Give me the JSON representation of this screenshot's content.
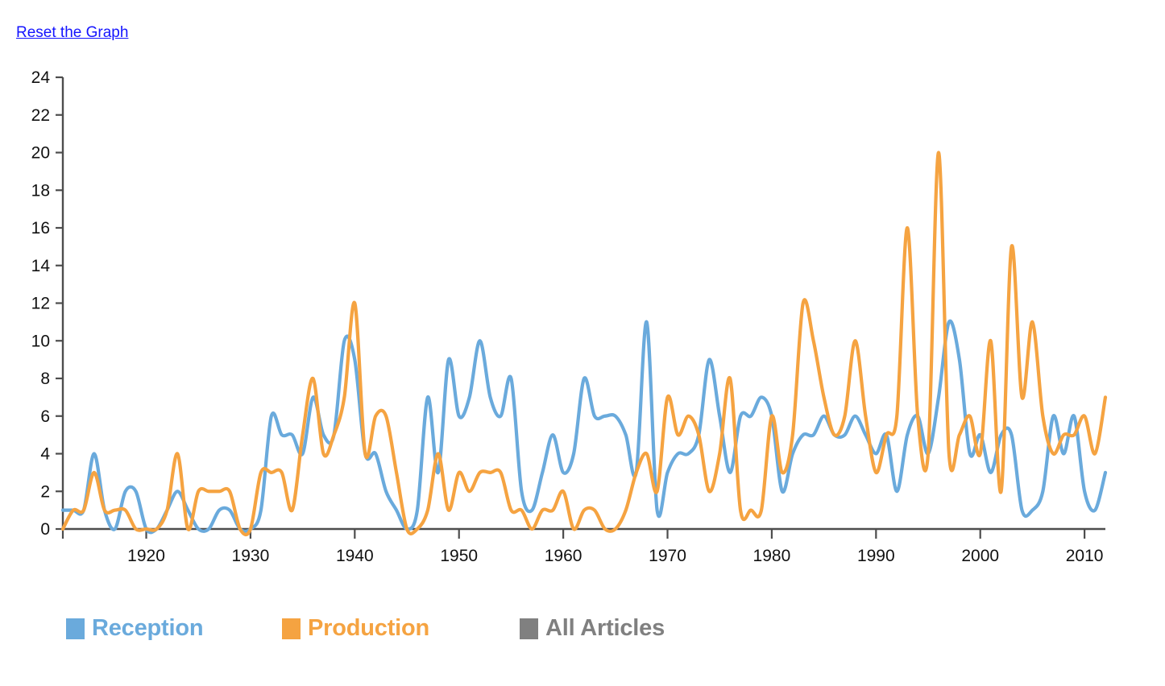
{
  "page": {
    "reset_link_label": "Reset the Graph",
    "link_color": "#1414ff"
  },
  "legend": {
    "entries": [
      {
        "label": "Reception",
        "color": "#6aaadc",
        "icon": "square-swatch-icon"
      },
      {
        "label": "Production",
        "color": "#f5a341",
        "icon": "square-swatch-icon"
      },
      {
        "label": "All Articles",
        "color": "#808080",
        "icon": "square-swatch-icon"
      }
    ]
  },
  "chart_data": {
    "type": "line",
    "title": "",
    "xlabel": "",
    "ylabel": "",
    "xlim": [
      1912,
      2012
    ],
    "ylim": [
      0,
      24
    ],
    "y_ticks": [
      0,
      2,
      4,
      6,
      8,
      10,
      12,
      14,
      16,
      18,
      20,
      22,
      24
    ],
    "x_ticks": [
      1920,
      1930,
      1940,
      1950,
      1960,
      1970,
      1980,
      1990,
      2000,
      2010
    ],
    "grid": false,
    "legend_position": "bottom",
    "smoothing": "monotone-spline",
    "x": [
      1912,
      1913,
      1914,
      1915,
      1916,
      1917,
      1918,
      1919,
      1920,
      1921,
      1922,
      1923,
      1924,
      1925,
      1926,
      1927,
      1928,
      1929,
      1930,
      1931,
      1932,
      1933,
      1934,
      1935,
      1936,
      1937,
      1938,
      1939,
      1940,
      1941,
      1942,
      1943,
      1944,
      1945,
      1946,
      1947,
      1948,
      1949,
      1950,
      1951,
      1952,
      1953,
      1954,
      1955,
      1956,
      1957,
      1958,
      1959,
      1960,
      1961,
      1962,
      1963,
      1964,
      1965,
      1966,
      1967,
      1968,
      1969,
      1970,
      1971,
      1972,
      1973,
      1974,
      1975,
      1976,
      1977,
      1978,
      1979,
      1980,
      1981,
      1982,
      1983,
      1984,
      1985,
      1986,
      1987,
      1988,
      1989,
      1990,
      1991,
      1992,
      1993,
      1994,
      1995,
      1996,
      1997,
      1998,
      1999,
      2000,
      2001,
      2002,
      2003,
      2004,
      2005,
      2006,
      2007,
      2008,
      2009,
      2010,
      2011,
      2012
    ],
    "series": [
      {
        "name": "Reception",
        "color": "#6aaadc",
        "values": [
          1,
          1,
          1,
          4,
          1,
          0,
          2,
          2,
          0,
          0,
          1,
          2,
          1,
          0,
          0,
          1,
          1,
          0,
          0,
          1,
          6,
          5,
          5,
          4,
          7,
          5,
          5,
          10,
          9,
          4,
          4,
          2,
          1,
          0,
          1,
          7,
          3,
          9,
          6,
          7,
          10,
          7,
          6,
          8,
          2,
          1,
          3,
          5,
          3,
          4,
          8,
          6,
          6,
          6,
          5,
          3,
          11,
          1,
          3,
          4,
          4,
          5,
          9,
          6,
          3,
          6,
          6,
          7,
          6,
          2,
          4,
          5,
          5,
          6,
          5,
          5,
          6,
          5,
          4,
          5,
          2,
          5,
          6,
          4,
          7,
          11,
          9,
          4,
          5,
          3,
          5,
          5,
          1,
          1,
          2,
          6,
          4,
          6,
          2,
          1,
          3
        ]
      },
      {
        "name": "Production",
        "color": "#f5a341",
        "values": [
          0,
          1,
          1,
          3,
          1,
          1,
          1,
          0,
          0,
          0,
          1,
          4,
          0,
          2,
          2,
          2,
          2,
          0,
          0,
          3,
          3,
          3,
          1,
          5,
          8,
          4,
          5,
          7,
          12,
          4,
          6,
          6,
          3,
          0,
          0,
          1,
          4,
          1,
          3,
          2,
          3,
          3,
          3,
          1,
          1,
          0,
          1,
          1,
          2,
          0,
          1,
          1,
          0,
          0,
          1,
          3,
          4,
          2,
          7,
          5,
          6,
          5,
          2,
          4,
          8,
          1,
          1,
          1,
          6,
          3,
          5,
          12,
          10,
          7,
          5,
          6,
          10,
          6,
          3,
          5,
          6,
          16,
          6,
          4,
          20,
          4,
          5,
          6,
          4,
          10,
          2,
          15,
          7,
          11,
          6,
          4,
          5,
          5,
          6,
          4,
          7
        ]
      }
    ],
    "hidden_series": [
      {
        "name": "All Articles",
        "color": "#808080",
        "visible": false
      }
    ]
  }
}
